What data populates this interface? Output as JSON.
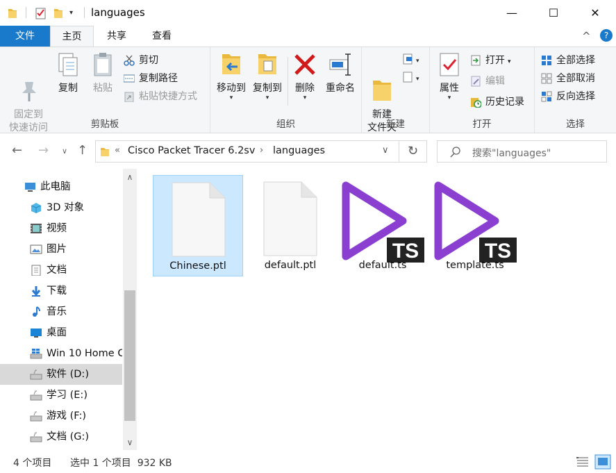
{
  "window": {
    "title": "languages",
    "minimize_glyph": "—",
    "maximize_glyph": "☐",
    "close_glyph": "✕"
  },
  "ribbon_tabs": [
    "文件",
    "主页",
    "共享",
    "查看"
  ],
  "ribbon_expand_glyph": "^",
  "help_glyph": "?",
  "ribbon": {
    "clipboard": {
      "label": "剪贴板",
      "pin": "固定到\n快速访问",
      "copy": "复制",
      "paste": "粘贴",
      "cut": "剪切",
      "copy_path": "复制路径",
      "paste_shortcut": "粘贴快捷方式"
    },
    "organize": {
      "label": "组织",
      "move_to": "移动到",
      "copy_to": "复制到",
      "delete": "删除",
      "rename": "重命名"
    },
    "new": {
      "label": "新建",
      "new_folder": "新建\n文件夹"
    },
    "open": {
      "label": "打开",
      "properties": "属性",
      "open": "打开",
      "edit": "编辑",
      "history": "历史记录"
    },
    "select": {
      "label": "选择",
      "select_all": "全部选择",
      "select_none": "全部取消",
      "invert": "反向选择"
    }
  },
  "address": {
    "crumbs": [
      "Cisco Packet Tracer 6.2sv",
      "languages"
    ],
    "search_placeholder": "搜索\"languages\""
  },
  "nav_pane": [
    {
      "label": "此电脑",
      "icon": "computer-icon"
    },
    {
      "label": "3D 对象",
      "icon": "3d-objects-icon"
    },
    {
      "label": "视频",
      "icon": "video-icon"
    },
    {
      "label": "图片",
      "icon": "pictures-icon"
    },
    {
      "label": "文档",
      "icon": "documents-icon"
    },
    {
      "label": "下载",
      "icon": "download-icon"
    },
    {
      "label": "音乐",
      "icon": "music-icon"
    },
    {
      "label": "桌面",
      "icon": "desktop-icon"
    },
    {
      "label": "Win 10 Home C",
      "icon": "windows-drive-icon"
    },
    {
      "label": "软件 (D:)",
      "icon": "drive-icon"
    },
    {
      "label": "学习 (E:)",
      "icon": "drive-icon"
    },
    {
      "label": "游戏 (F:)",
      "icon": "drive-icon"
    },
    {
      "label": "文档 (G:)",
      "icon": "drive-icon"
    }
  ],
  "files": [
    {
      "name": "Chinese.ptl",
      "icon": "blank-file-icon",
      "selected": true
    },
    {
      "name": "default.ptl",
      "icon": "blank-file-icon",
      "selected": false
    },
    {
      "name": "default.ts",
      "icon": "ts-media-icon",
      "selected": false
    },
    {
      "name": "template.ts",
      "icon": "ts-media-icon",
      "selected": false
    }
  ],
  "ts_badge": "TS",
  "status": {
    "count": "4 个项目",
    "selection": "选中 1 个项目  932 KB"
  },
  "colors": {
    "file_tab": "#1979ca",
    "selection": "#cce8ff",
    "ts_purple": "#8a3fd1"
  }
}
